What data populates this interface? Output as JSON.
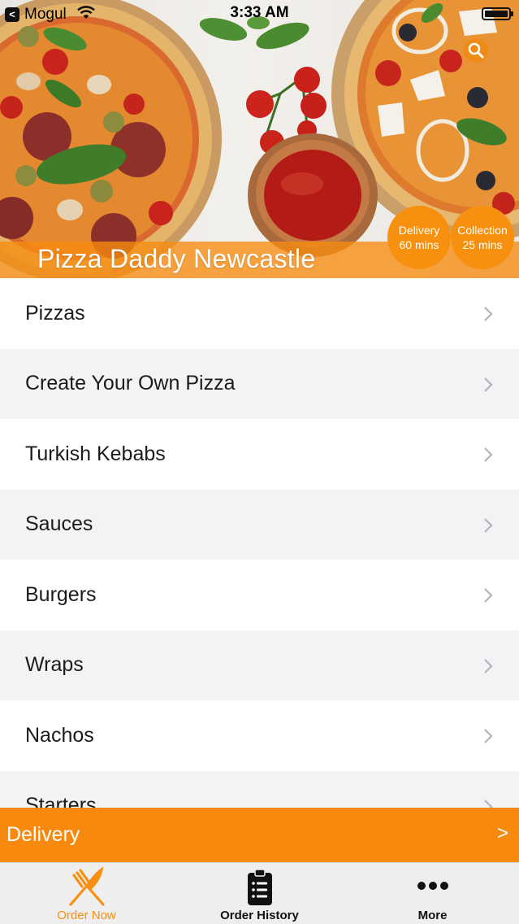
{
  "status_bar": {
    "back_app": "Mogul",
    "back_chip": "<",
    "time": "3:33 AM"
  },
  "header": {
    "restaurant_name": "Pizza Daddy Newcastle",
    "delivery_badge": {
      "label": "Delivery",
      "time": "60 mins"
    },
    "collection_badge": {
      "label": "Collection",
      "time": "25 mins"
    }
  },
  "menu": {
    "items": [
      {
        "label": "Pizzas"
      },
      {
        "label": "Create Your Own Pizza"
      },
      {
        "label": "Turkish Kebabs"
      },
      {
        "label": "Sauces"
      },
      {
        "label": "Burgers"
      },
      {
        "label": "Wraps"
      },
      {
        "label": "Nachos"
      },
      {
        "label": "Starters"
      }
    ]
  },
  "order_bar": {
    "mode_label": "Delivery",
    "arrow": ">"
  },
  "tab_bar": {
    "tabs": [
      {
        "label": "Order Now",
        "icon": "fork-knife-icon",
        "active": true
      },
      {
        "label": "Order History",
        "icon": "clipboard-list-icon",
        "active": false
      },
      {
        "label": "More",
        "icon": "more-dots-icon",
        "active": false
      }
    ]
  },
  "colors": {
    "accent": "#f7890f",
    "tab_bar_bg": "#eeeeef",
    "row_alt_bg": "#f3f3f5"
  }
}
